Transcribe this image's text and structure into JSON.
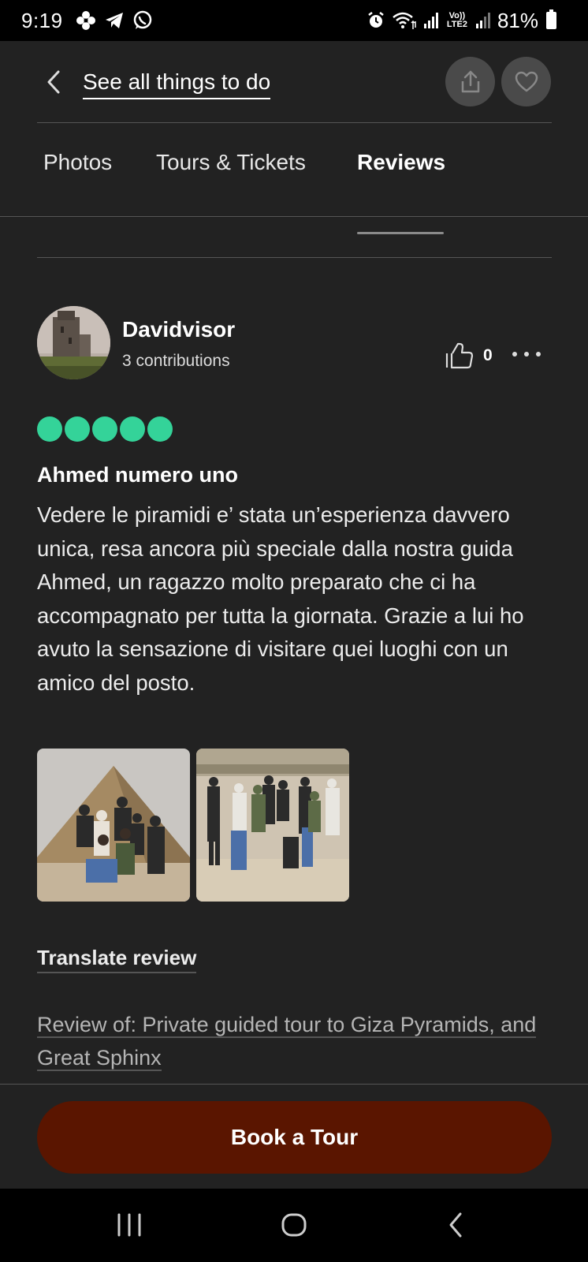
{
  "status_bar": {
    "time": "9:19",
    "battery": "81%",
    "network": "Vo)) LTE2",
    "left_icons": [
      "pinwheel-icon",
      "telegram-icon",
      "whatsapp-icon"
    ],
    "right_icons": [
      "alarm-icon",
      "wifi-icon",
      "signal-icon",
      "signal-icon",
      "battery-icon"
    ]
  },
  "header": {
    "back_label": "See all things to do",
    "icons": [
      "chevron-left-icon",
      "share-icon",
      "heart-icon"
    ]
  },
  "tabs": [
    {
      "label": "Photos",
      "active": false
    },
    {
      "label": "Tours & Tickets",
      "active": false
    },
    {
      "label": "Reviews",
      "active": true
    }
  ],
  "review": {
    "user_name": "Davidvisor",
    "contributions": "3 contributions",
    "like_count": "0",
    "rating": 5,
    "rating_max": 5,
    "title": "Ahmed numero uno",
    "body": "Vedere le piramidi e’ stata un’esperienza davvero unica, resa ancora più speciale dalla nostra guida Ahmed, un ragazzo molto preparato che ci ha accompagnato per tutta la giornata. Grazie a lui ho avuto la sensazione di visitare quei luoghi con un amico del posto.",
    "photo_count": 2,
    "translate_label": "Translate review",
    "review_of": "Review of: Private guided tour to Giza Pyramids, and Great Sphinx"
  },
  "cta": {
    "label": "Book a Tour"
  },
  "colors": {
    "background": "#222222",
    "rating_bubble": "#34d399",
    "cta_background": "#5a1500"
  }
}
